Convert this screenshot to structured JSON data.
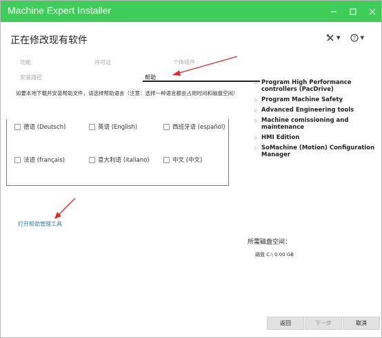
{
  "window": {
    "title": "Machine Expert Installer"
  },
  "heading": "正在修改现有软件",
  "tabs": [
    {
      "label": "功能"
    },
    {
      "label": "许可证"
    },
    {
      "label": "个体组件"
    },
    {
      "label": "安装路径"
    },
    {
      "label": "帮助"
    }
  ],
  "description": "如要本地下载并安装帮助文件，请选择帮助语言（注意：选择一种语言都会占用时间和磁盘空间）",
  "languages": [
    {
      "label": "德语 (Deutsch)"
    },
    {
      "label": "英语 (English)"
    },
    {
      "label": "西班牙语 (español)"
    },
    {
      "label": "法语 (français)"
    },
    {
      "label": "意大利语 (italiano)"
    },
    {
      "label": "中文 (中文)"
    }
  ],
  "open_help_tool": "打开帮助管理工具",
  "features": [
    {
      "label": "Program High Performance controllers (PacDrive)"
    },
    {
      "label": "Program Machine Safety"
    },
    {
      "label": "Advanced Engineering tools"
    },
    {
      "label": "Machine comissioning and maintenance"
    },
    {
      "label": "HMI Edition"
    },
    {
      "label": "SoMachine (Motion) Configuration Manager"
    }
  ],
  "disk": {
    "label": "所需磁盘空间：",
    "value": "磁盘 C:\\ 0.00 GB"
  },
  "footer": {
    "back": "返回",
    "next": "下一步",
    "cancel": "取消"
  },
  "colors": {
    "titlebar": "#3dcd58",
    "arrow": "#e0282a",
    "link": "#2a7fb0"
  },
  "icons": {
    "tools": "tools-icon",
    "help": "help-icon"
  }
}
